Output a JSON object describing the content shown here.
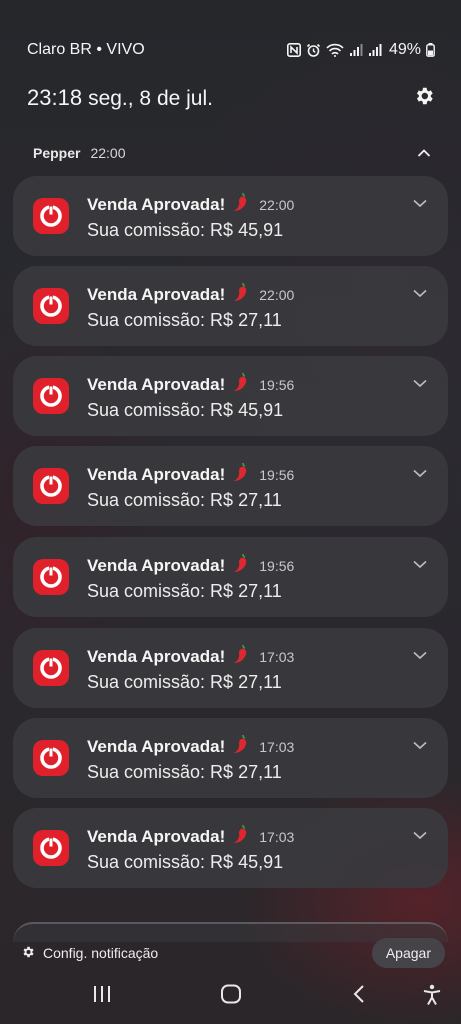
{
  "status_bar": {
    "carrier": "Claro BR • VIVO",
    "battery": "49%",
    "icons": [
      "nfc-icon",
      "alarm-icon",
      "wifi-icon",
      "signal-icon",
      "signal-icon",
      "battery-icon"
    ]
  },
  "header": {
    "time": "23:18",
    "date": "seg., 8 de jul.",
    "settings_icon": "gear-icon"
  },
  "group": {
    "app_name": "Pepper",
    "time": "22:00",
    "collapse_icon": "chevron-up-icon"
  },
  "notifications": [
    {
      "title": "Venda Aprovada!",
      "emoji": "🌶️",
      "time": "22:00",
      "body": "Sua comissão: R$ 45,91"
    },
    {
      "title": "Venda Aprovada!",
      "emoji": "🌶️",
      "time": "22:00",
      "body": "Sua comissão: R$ 27,11"
    },
    {
      "title": "Venda Aprovada!",
      "emoji": "🌶️",
      "time": "19:56",
      "body": "Sua comissão: R$ 45,91"
    },
    {
      "title": "Venda Aprovada!",
      "emoji": "🌶️",
      "time": "19:56",
      "body": "Sua comissão: R$ 27,11"
    },
    {
      "title": "Venda Aprovada!",
      "emoji": "🌶️",
      "time": "19:56",
      "body": "Sua comissão: R$ 27,11"
    },
    {
      "title": "Venda Aprovada!",
      "emoji": "🌶️",
      "time": "17:03",
      "body": "Sua comissão: R$ 27,11"
    },
    {
      "title": "Venda Aprovada!",
      "emoji": "🌶️",
      "time": "17:03",
      "body": "Sua comissão: R$ 27,11"
    },
    {
      "title": "Venda Aprovada!",
      "emoji": "🌶️",
      "time": "17:03",
      "body": "Sua comissão: R$ 45,91"
    }
  ],
  "footer": {
    "settings_label": "Config. notificação",
    "clear_label": "Apagar"
  },
  "navbar": {
    "buttons": [
      "recents-icon",
      "home-icon",
      "back-icon",
      "accessibility-icon"
    ]
  },
  "colors": {
    "app_icon": "#e0212b",
    "card": "#3a3a3e"
  }
}
